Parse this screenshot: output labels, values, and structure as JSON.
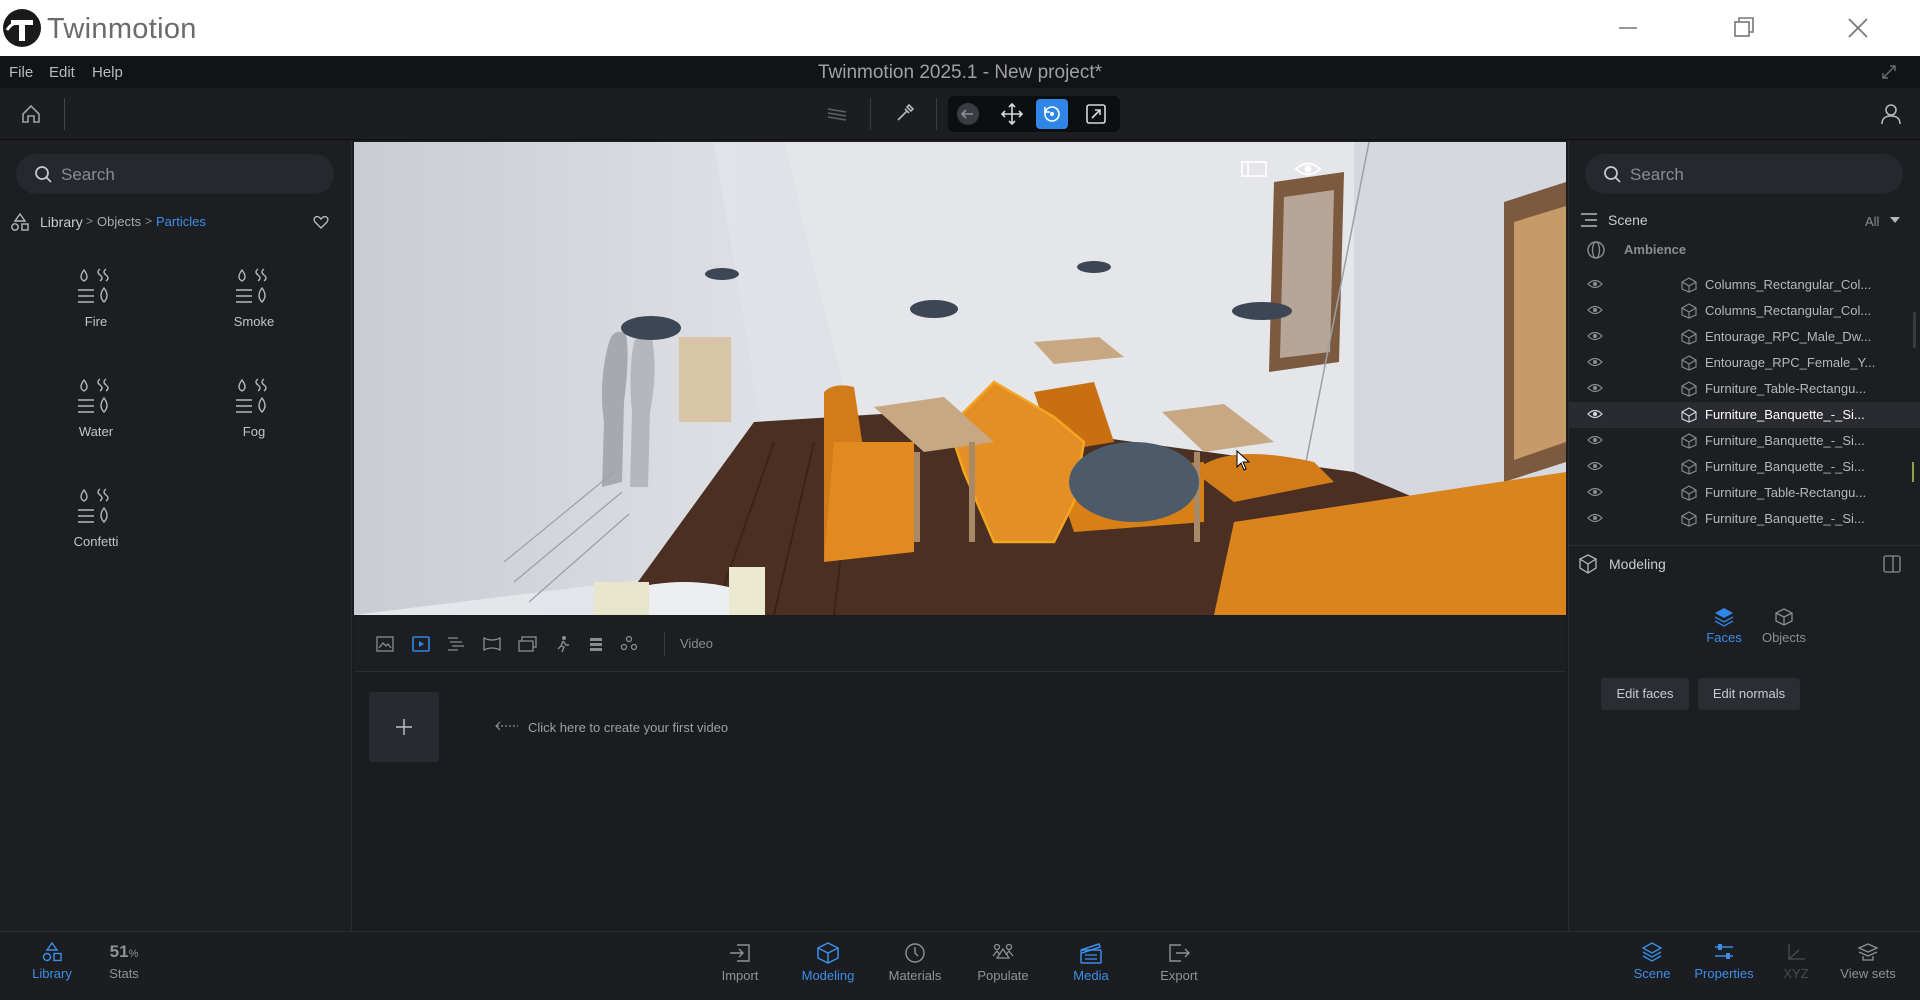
{
  "app": {
    "name": "Twinmotion",
    "window_title": "Twinmotion 2025.1 - New project*"
  },
  "menu": [
    "File",
    "Edit",
    "Help"
  ],
  "colors": {
    "accent": "#2f86e6",
    "selection_outline": "#f2a623",
    "background": "#1b1c20"
  },
  "library": {
    "search_placeholder": "Search",
    "breadcrumb": [
      "Library",
      "Objects",
      "Particles"
    ],
    "items": [
      {
        "label": "Fire",
        "icon": "particles-icon"
      },
      {
        "label": "Smoke",
        "icon": "particles-icon"
      },
      {
        "label": "Water",
        "icon": "particles-icon"
      },
      {
        "label": "Fog",
        "icon": "particles-icon"
      },
      {
        "label": "Confetti",
        "icon": "particles-icon"
      }
    ]
  },
  "media": {
    "video_label": "Video",
    "create_hint": "Click here to create your first video"
  },
  "scene": {
    "search_placeholder": "Search",
    "title": "Scene",
    "filter": "All",
    "ambience_label": "Ambience",
    "rows": [
      {
        "label": "Columns_Rectangular_Col...",
        "selected": false
      },
      {
        "label": "Columns_Rectangular_Col...",
        "selected": false
      },
      {
        "label": "Entourage_RPC_Male_Dw...",
        "selected": false
      },
      {
        "label": "Entourage_RPC_Female_Y...",
        "selected": false
      },
      {
        "label": "Furniture_Table-Rectangu...",
        "selected": false
      },
      {
        "label": "Furniture_Banquette_-_Si...",
        "selected": true
      },
      {
        "label": "Furniture_Banquette_-_Si...",
        "selected": false
      },
      {
        "label": "Furniture_Banquette_-_Si...",
        "selected": false
      },
      {
        "label": "Furniture_Table-Rectangu...",
        "selected": false
      },
      {
        "label": "Furniture_Banquette_-_Si...",
        "selected": false
      }
    ]
  },
  "modeling": {
    "title": "Modeling",
    "tabs": [
      {
        "label": "Faces",
        "active": true
      },
      {
        "label": "Objects",
        "active": false
      }
    ],
    "buttons": [
      "Edit faces",
      "Edit normals"
    ]
  },
  "bottombar": {
    "left": [
      {
        "label": "Library",
        "active": true
      },
      {
        "label": "Stats",
        "value": "51",
        "unit": "%"
      }
    ],
    "center": [
      {
        "label": "Import",
        "active": false
      },
      {
        "label": "Modeling",
        "active": true
      },
      {
        "label": "Materials",
        "active": false
      },
      {
        "label": "Populate",
        "active": false
      },
      {
        "label": "Media",
        "active": true
      },
      {
        "label": "Export",
        "active": false
      }
    ],
    "right": [
      {
        "label": "Scene",
        "active": true
      },
      {
        "label": "Properties",
        "active": true
      },
      {
        "label": "XYZ",
        "active": false,
        "disabled": true
      },
      {
        "label": "View sets",
        "active": false
      }
    ]
  }
}
